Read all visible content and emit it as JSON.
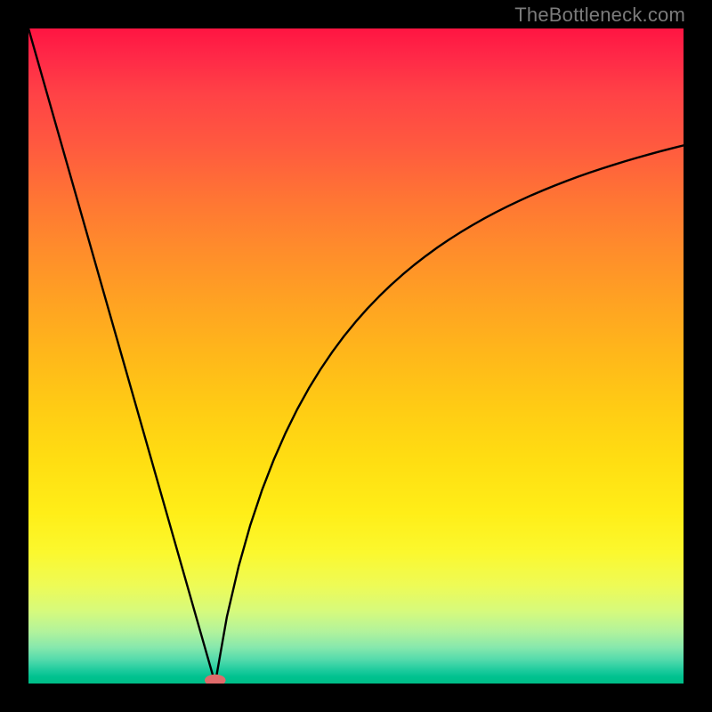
{
  "watermark": "TheBottleneck.com",
  "colors": {
    "frame": "#000000",
    "curve": "#000000",
    "marker": "#e06b6b",
    "marker_ring": "#d95a5a",
    "gradient_top": "#ff1542",
    "gradient_mid": "#ffcc14",
    "gradient_bottom": "#00be88"
  },
  "chart_data": {
    "type": "line",
    "title": "",
    "xlabel": "",
    "ylabel": "",
    "xlim": [
      0,
      100
    ],
    "ylim": [
      0,
      100
    ],
    "grid": false,
    "legend": false,
    "notes": "Bottleneck-style V curve. Left branch is approximately linear descending from the top-left corner to the minimum; right branch rises with a decelerating (sqrt/log-like) curve toward the right edge. Minimum touches y≈0 near x≈28.5. A small oval marker sits at the minimum.",
    "min_point": {
      "x": 28.5,
      "y": 0
    },
    "series": [
      {
        "name": "left-branch",
        "x": [
          0.0,
          2.85,
          5.7,
          8.55,
          11.4,
          14.25,
          17.1,
          19.95,
          22.8,
          25.65,
          28.5
        ],
        "y": [
          100.0,
          90.0,
          80.0,
          70.0,
          60.0,
          50.0,
          40.0,
          30.0,
          20.0,
          10.0,
          0.0
        ]
      },
      {
        "name": "right-branch",
        "x": [
          28.5,
          30.29,
          32.08,
          33.86,
          35.65,
          37.44,
          39.23,
          41.01,
          42.8,
          44.59,
          46.38,
          48.16,
          49.95,
          51.74,
          53.53,
          55.31,
          57.1,
          58.89,
          60.68,
          62.46,
          64.25,
          66.04,
          67.83,
          69.61,
          71.4,
          73.19,
          74.98,
          76.76,
          78.55,
          80.34,
          82.13,
          83.91,
          85.7,
          87.49,
          89.28,
          91.06,
          92.85,
          94.64,
          96.43,
          98.21,
          100.0
        ],
        "y": [
          0.0,
          10.19,
          17.87,
          24.17,
          29.52,
          34.15,
          38.22,
          41.83,
          45.07,
          47.98,
          50.62,
          53.02,
          55.22,
          57.24,
          59.1,
          60.82,
          62.42,
          63.91,
          65.29,
          66.59,
          67.8,
          68.94,
          70.01,
          71.02,
          71.97,
          72.87,
          73.72,
          74.53,
          75.29,
          76.02,
          76.71,
          77.37,
          78.0,
          78.6,
          79.17,
          79.72,
          80.25,
          80.75,
          81.24,
          81.7,
          82.15
        ]
      }
    ],
    "marker": {
      "shape": "ellipse",
      "cx": 28.5,
      "cy": 0.5,
      "rx": 1.6,
      "ry": 0.9,
      "fill": "#e06b6b"
    }
  }
}
